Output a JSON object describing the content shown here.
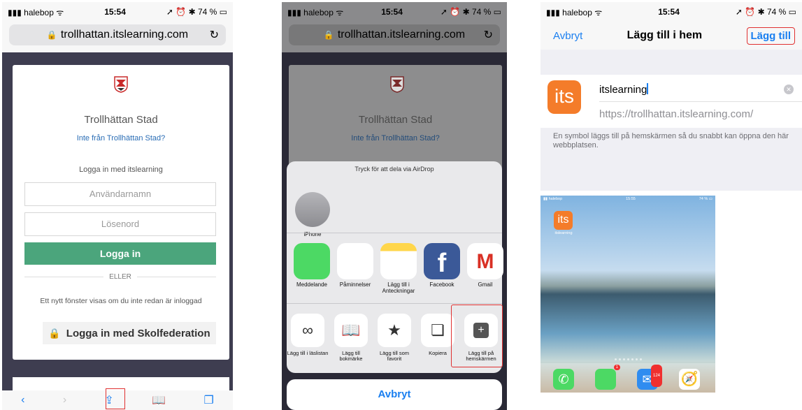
{
  "panel1": {
    "status": {
      "carrier": "halebop",
      "time": "15:54",
      "battery": "74 %"
    },
    "url": "trollhattan.itslearning.com",
    "org_name": "Trollhättan Stad",
    "not_from": "Inte från Trollhättan Stad?",
    "login_with": "Logga in med itslearning",
    "username_placeholder": "Användarnamn",
    "password_placeholder": "Lösenord",
    "login_button": "Logga in",
    "or_label": "ELLER",
    "new_window_note": "Ett nytt fönster visas om du inte redan är inloggad",
    "skolfederation_button": "Logga in med Skolfederation"
  },
  "panel2": {
    "status": {
      "carrier": "halebop",
      "time": "15:54",
      "battery": "74 %"
    },
    "url": "trollhattan.itslearning.com",
    "org_name": "Trollhättan Stad",
    "not_from": "Inte från Trollhättan Stad?",
    "airdrop_title": "Tryck för att dela via AirDrop",
    "airdrop_device": "iPhone",
    "apps": [
      {
        "label": "Meddelande"
      },
      {
        "label": "Påminnelser"
      },
      {
        "label": "Lägg till i Anteckningar"
      },
      {
        "label": "Facebook"
      },
      {
        "label": "Gmail"
      }
    ],
    "actions": [
      {
        "label": "Lägg till i läslistan",
        "icon": "glasses-icon"
      },
      {
        "label": "Lägg till bokmärke",
        "icon": "book-icon"
      },
      {
        "label": "Lägg till som favorit",
        "icon": "star-icon"
      },
      {
        "label": "Kopiera",
        "icon": "copy-icon"
      },
      {
        "label": "Lägg till på hemskärmen",
        "icon": "plus-icon"
      }
    ],
    "cancel": "Avbryt"
  },
  "panel3": {
    "status": {
      "carrier": "halebop",
      "time": "15:54",
      "battery": "74 %"
    },
    "cancel": "Avbryt",
    "title": "Lägg till i hem",
    "add": "Lägg till",
    "icon_text": "its",
    "name_value": "itslearning",
    "url": "https://trollhattan.itslearning.com/",
    "note": "En symbol läggs till på hemskärmen så du snabbt kan öppna den här webbplatsen."
  },
  "panel4": {
    "status": {
      "carrier": "halebop",
      "time": "15:55",
      "battery": "74 %"
    },
    "app_icon_text": "its",
    "app_label": "itslearning",
    "badges": {
      "messages": "1",
      "mail": "124"
    }
  }
}
